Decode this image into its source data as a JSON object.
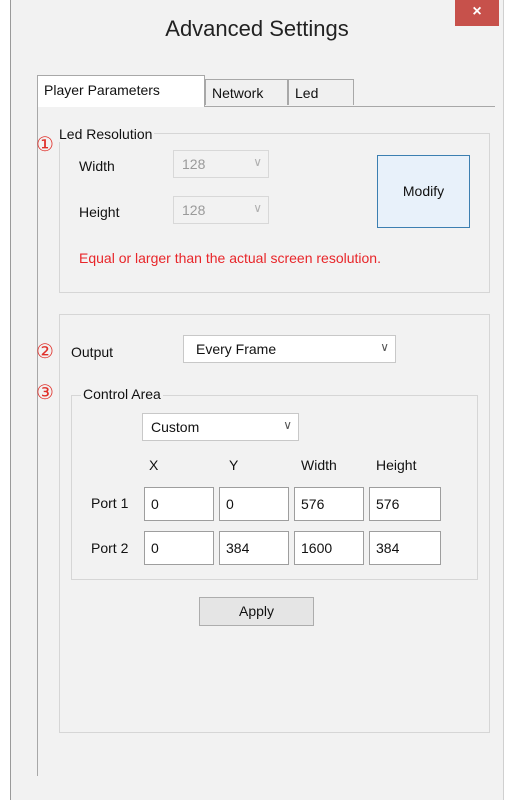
{
  "window": {
    "title": "Advanced Settings",
    "close_label": "×"
  },
  "tabs": [
    "Player Parameters",
    "Network",
    "Led"
  ],
  "markers": [
    "①",
    "②",
    "③"
  ],
  "led_resolution": {
    "group_label": "Led Resolution",
    "width_label": "Width",
    "width_value": "128",
    "height_label": "Height",
    "height_value": "128",
    "modify_label": "Modify",
    "warning": "Equal or larger than the actual screen resolution."
  },
  "output": {
    "label": "Output",
    "value": "Every Frame"
  },
  "control_area": {
    "group_label": "Control Area",
    "mode_value": "Custom",
    "columns": [
      "X",
      "Y",
      "Width",
      "Height"
    ],
    "rows": [
      {
        "port": "Port 1",
        "values": [
          "0",
          "0",
          "576",
          "576"
        ]
      },
      {
        "port": "Port 2",
        "values": [
          "0",
          "384",
          "1600",
          "384"
        ]
      }
    ]
  },
  "apply_label": "Apply",
  "colors": {
    "warning": "#e8262a",
    "close_button": "#c7514b",
    "marker": "#e0302a"
  },
  "icons": {
    "dropdown": "chevron-down-icon",
    "close": "close-icon"
  }
}
